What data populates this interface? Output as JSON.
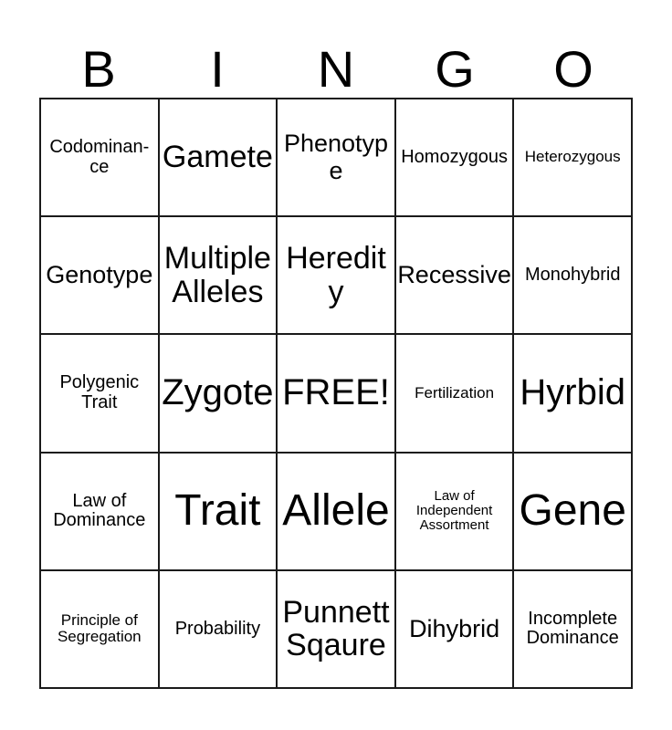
{
  "header": {
    "letters": [
      "B",
      "I",
      "N",
      "G",
      "O"
    ]
  },
  "grid": {
    "rows": [
      [
        {
          "label": "Codominan-\nce",
          "size": "fs-sm"
        },
        {
          "label": "Gamete",
          "size": "fs-lg"
        },
        {
          "label": "Phenotype",
          "size": "fs-md"
        },
        {
          "label": "Homozygous",
          "size": "fs-sm"
        },
        {
          "label": "Heterozygous",
          "size": "fs-xs"
        }
      ],
      [
        {
          "label": "Genotype",
          "size": "fs-md"
        },
        {
          "label": "Multiple\nAlleles",
          "size": "fs-lg"
        },
        {
          "label": "Heredity",
          "size": "fs-lg"
        },
        {
          "label": "Recessive",
          "size": "fs-md"
        },
        {
          "label": "Monohybrid",
          "size": "fs-sm"
        }
      ],
      [
        {
          "label": "Polygenic\nTrait",
          "size": "fs-sm"
        },
        {
          "label": "Zygote",
          "size": "fs-xl"
        },
        {
          "label": "FREE!",
          "size": "fs-xl"
        },
        {
          "label": "Fertilization",
          "size": "fs-xs"
        },
        {
          "label": "Hyrbid",
          "size": "fs-xl"
        }
      ],
      [
        {
          "label": "Law of\nDominance",
          "size": "fs-sm"
        },
        {
          "label": "Trait",
          "size": "fs-xxl"
        },
        {
          "label": "Allele",
          "size": "fs-xxl"
        },
        {
          "label": "Law of\nIndependent\nAssortment",
          "size": "fs-xxs"
        },
        {
          "label": "Gene",
          "size": "fs-xxl"
        }
      ],
      [
        {
          "label": "Principle of\nSegregation",
          "size": "fs-xs"
        },
        {
          "label": "Probability",
          "size": "fs-sm"
        },
        {
          "label": "Punnett\nSqaure",
          "size": "fs-lg"
        },
        {
          "label": "Dihybrid",
          "size": "fs-md"
        },
        {
          "label": "Incomplete\nDominance",
          "size": "fs-sm"
        }
      ]
    ]
  }
}
